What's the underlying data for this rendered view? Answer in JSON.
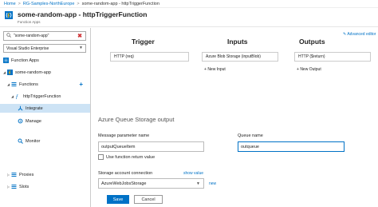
{
  "breadcrumb": [
    "Home",
    "RG-Samples-NorthEurope",
    "some-random-app - httpTriggerFunction"
  ],
  "header": {
    "title": "some-random-app - httpTriggerFunction",
    "subtitle": "Function Apps"
  },
  "sidebar": {
    "search_value": "\"some-random-app\"",
    "subscription": "Visual Studio Enterprise",
    "items": [
      {
        "label": "Function Apps"
      },
      {
        "label": "some-random-app"
      },
      {
        "label": "Functions"
      },
      {
        "label": "httpTriggerFunction"
      },
      {
        "label": "Integrate"
      },
      {
        "label": "Manage"
      },
      {
        "label": "Monitor"
      },
      {
        "label": "Proxies"
      },
      {
        "label": "Slots"
      }
    ]
  },
  "integrate": {
    "advanced_link": "Advanced editor",
    "trigger": {
      "heading": "Trigger",
      "item": "HTTP (req)"
    },
    "inputs": {
      "heading": "Inputs",
      "item": "Azure Blob Storage (inputBlob)",
      "new": "New Input"
    },
    "outputs": {
      "heading": "Outputs",
      "item": "HTTP ($return)",
      "new": "New Output"
    }
  },
  "form": {
    "section_title": "Azure Queue Storage output",
    "param_label": "Message parameter name",
    "param_value": "outputQueueItem",
    "use_return_label": "Use function return value",
    "queue_label": "Queue name",
    "queue_value": "outqueue",
    "conn_label": "Storage account connection",
    "show_value": "show value",
    "conn_value": "AzureWebJobsStorage",
    "new_link": "new",
    "save": "Save",
    "cancel": "Cancel"
  },
  "colors": {
    "accent": "#0072c6",
    "selected_bg": "#cde3f5",
    "close": "#d13438"
  }
}
